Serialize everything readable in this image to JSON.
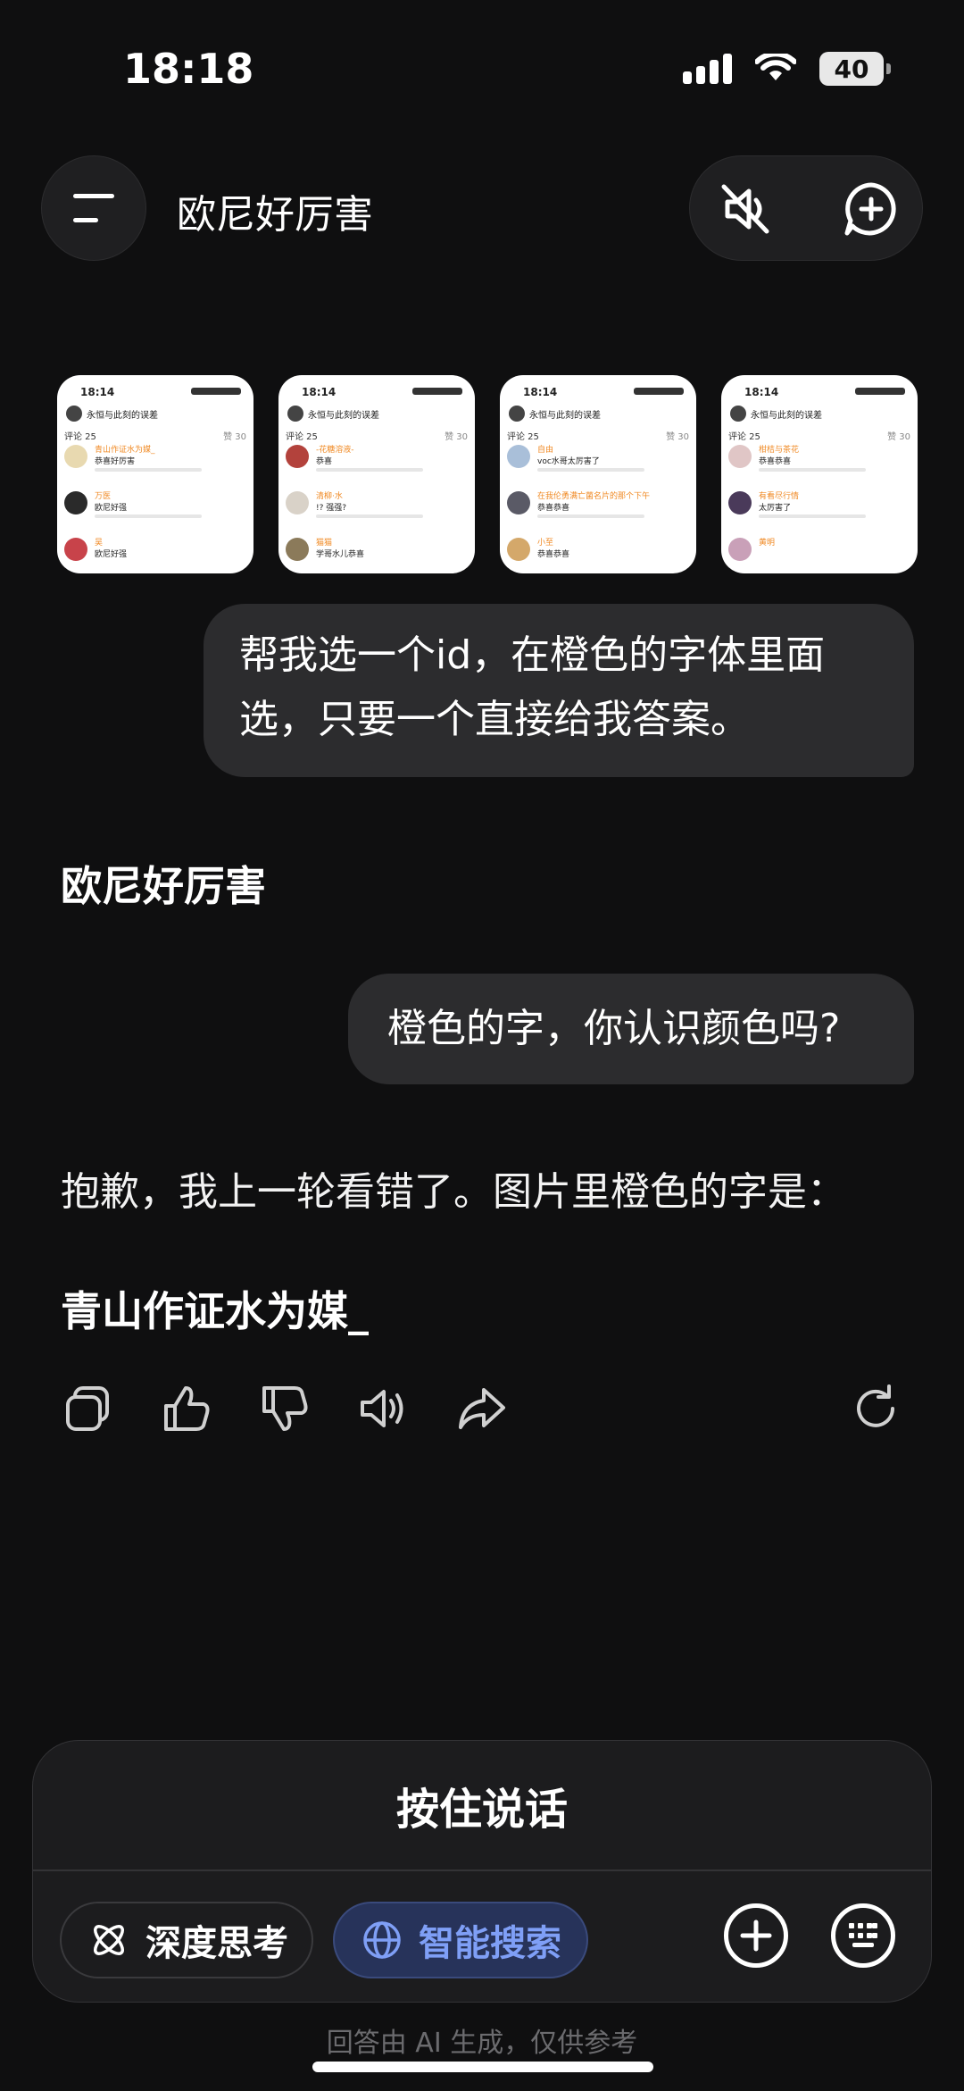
{
  "status": {
    "time": "18:18",
    "battery": "40"
  },
  "header": {
    "title": "欧尼好厉害"
  },
  "thumbnails": [
    {
      "time": "18:14",
      "title": "永恒与此刻的误差",
      "tab": "评论 25",
      "likes": "赞 30",
      "rows": [
        {
          "name": "青山作证水为媒_",
          "text": "恭喜好厉害"
        },
        {
          "name": "万医",
          "text": "欧尼好强"
        },
        {
          "name": "吴",
          "text": "欧尼好强"
        }
      ]
    },
    {
      "time": "18:14",
      "title": "永恒与此刻的误差",
      "tab": "评论 25",
      "likes": "赞 30",
      "rows": [
        {
          "name": "-花糖溶液-",
          "text": "恭喜"
        },
        {
          "name": "清柳·水",
          "text": "!? 强强?"
        },
        {
          "name": "猫猫",
          "text": "学哥水儿恭喜"
        }
      ]
    },
    {
      "time": "18:14",
      "title": "永恒与此刻的误差",
      "tab": "评论 25",
      "likes": "赞 30",
      "rows": [
        {
          "name": "自由",
          "text": "voc水哥太厉害了"
        },
        {
          "name": "在我伦勇满亡菌名片的那个下午",
          "text": "恭喜恭喜"
        },
        {
          "name": "小至",
          "text": "恭喜恭喜"
        }
      ]
    },
    {
      "time": "18:14",
      "title": "永恒与此刻的误差",
      "tab": "评论 25",
      "likes": "赞 30",
      "rows": [
        {
          "name": "柑桔与茶花",
          "text": "恭喜恭喜"
        },
        {
          "name": "有看尽行情",
          "text": "太厉害了"
        },
        {
          "name": "黄明",
          "text": ""
        }
      ]
    }
  ],
  "messages": {
    "user1": "帮我选一个id，在橙色的字体里面选，只要一个直接给我答案。",
    "ai1": "欧尼好厉害",
    "user2": "橙色的字，你认识颜色吗?",
    "ai2": "抱歉，我上一轮看错了。图片里橙色的字是：",
    "ai3": "青山作证水为媒_"
  },
  "icons": {
    "actions": [
      "copy-icon",
      "thumbs-up-icon",
      "thumbs-down-icon",
      "speaker-icon",
      "share-icon",
      "refresh-icon"
    ],
    "header": [
      "menu-icon",
      "mute-icon",
      "new-chat-icon"
    ]
  },
  "input": {
    "hold_to_talk": "按住说话",
    "deep_think": "深度思考",
    "smart_search": "智能搜索"
  },
  "footer": {
    "note": "回答由 AI 生成，仅供参考"
  },
  "colors": {
    "background": "#0f0f10",
    "bubble": "#2c2c2e",
    "accent": "#7f9ff6",
    "orange": "#f08a24"
  }
}
